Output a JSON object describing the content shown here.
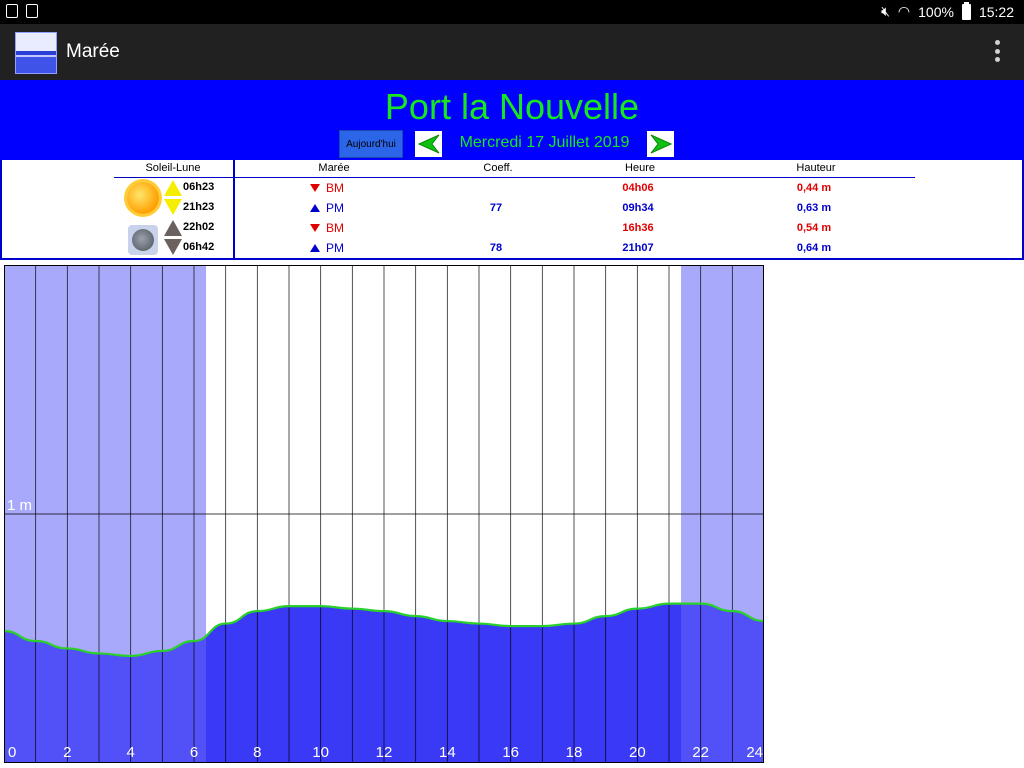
{
  "status_bar": {
    "battery": "100%",
    "time": "15:22"
  },
  "app": {
    "title": "Marée"
  },
  "header": {
    "port": "Port la Nouvelle",
    "today_button": "Aujourd'hui",
    "date": "Mercredi 17 Juillet 2019"
  },
  "table": {
    "headers": {
      "soleil_lune": "Soleil-Lune",
      "maree": "Marée",
      "coeff": "Coeff.",
      "heure": "Heure",
      "hauteur": "Hauteur"
    },
    "sun": {
      "rise": "06h23",
      "set": "21h23"
    },
    "moon": {
      "rise": "22h02",
      "set": "06h42"
    },
    "rows": [
      {
        "type": "BM",
        "coeff": "",
        "heure": "04h06",
        "hauteur": "0,44 m",
        "color": "#e00000"
      },
      {
        "type": "PM",
        "coeff": "77",
        "heure": "09h34",
        "hauteur": "0,63 m",
        "color": "#0000cc"
      },
      {
        "type": "BM",
        "coeff": "",
        "heure": "16h36",
        "hauteur": "0,54 m",
        "color": "#e00000"
      },
      {
        "type": "PM",
        "coeff": "78",
        "heure": "21h07",
        "hauteur": "0,64 m",
        "color": "#0000cc"
      }
    ]
  },
  "chart_data": {
    "type": "area",
    "x": [
      0,
      1,
      2,
      3,
      4,
      5,
      6,
      7,
      8,
      9,
      10,
      11,
      12,
      13,
      14,
      15,
      16,
      17,
      18,
      19,
      20,
      21,
      22,
      23,
      24
    ],
    "values": [
      0.53,
      0.49,
      0.46,
      0.44,
      0.43,
      0.45,
      0.49,
      0.56,
      0.61,
      0.63,
      0.63,
      0.62,
      0.61,
      0.59,
      0.57,
      0.56,
      0.55,
      0.55,
      0.56,
      0.59,
      0.62,
      0.64,
      0.64,
      0.61,
      0.57
    ],
    "xlim": [
      0,
      24
    ],
    "ylim": [
      0,
      2
    ],
    "x_ticks": [
      0,
      2,
      4,
      6,
      8,
      10,
      12,
      14,
      16,
      18,
      20,
      22,
      24
    ],
    "y_label_1m": "1 m",
    "night_intervals": [
      [
        0,
        6.38
      ],
      [
        21.38,
        24
      ]
    ],
    "colors": {
      "water": "#3a3af6",
      "night_bg": "#a9a9fb",
      "night_water": "#5151f7",
      "curve": "#2ad12a"
    }
  }
}
